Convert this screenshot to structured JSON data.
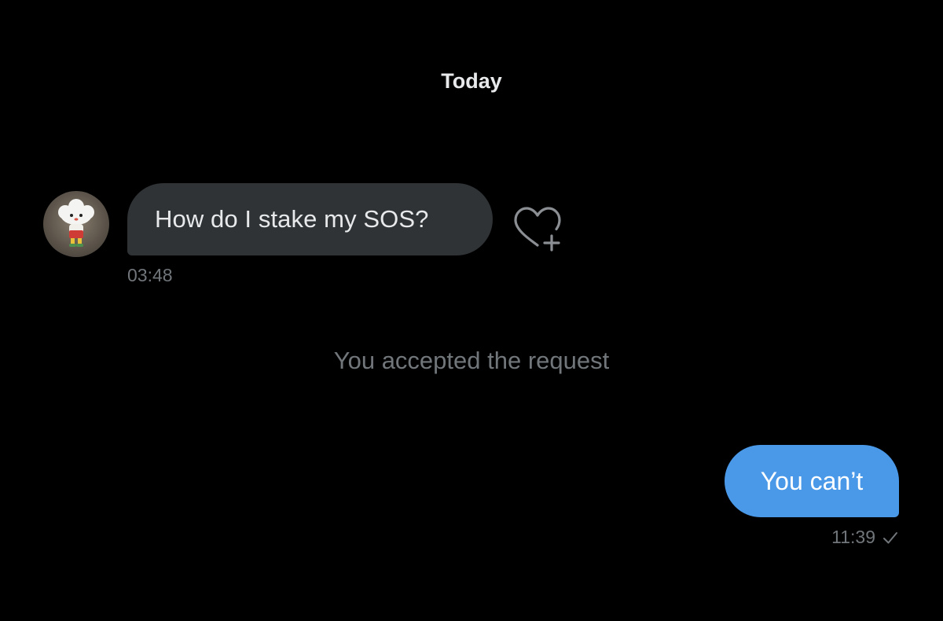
{
  "conversation": {
    "date_divider": "Today",
    "incoming": {
      "text": "How do I stake my SOS?",
      "time": "03:48",
      "avatar_icon": "cloud-character-avatar",
      "reaction_icon": "heart-plus-icon"
    },
    "system_message": "You accepted the request",
    "outgoing": {
      "text": "You can’t",
      "time": "11:39",
      "status_icon": "check-icon"
    }
  },
  "colors": {
    "background": "#000000",
    "incoming_bubble": "#2f3336",
    "outgoing_bubble": "#4a99e9",
    "primary_text": "#e7e9ea",
    "secondary_text": "#71767b"
  }
}
